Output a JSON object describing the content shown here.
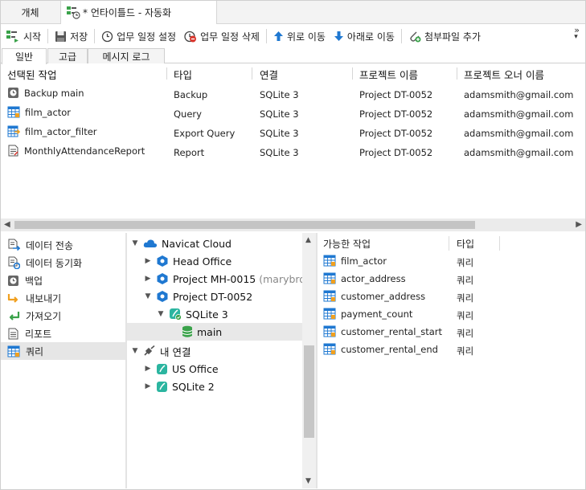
{
  "tabs": {
    "objects_label": "개체",
    "active_label": "* 언타이틀드 - 자동화"
  },
  "toolbar": {
    "start": "시작",
    "save": "저장",
    "set_schedule": "업무 일정 설정",
    "delete_schedule": "업무 일정 삭제",
    "move_up": "위로 이동",
    "move_down": "아래로 이동",
    "add_attachment": "첨부파일 추가",
    "overflow": "»"
  },
  "subtabs": [
    "일반",
    "고급",
    "메시지 로그"
  ],
  "jobs": {
    "columns": [
      "선택된 작업",
      "타입",
      "연결",
      "프로젝트 이름",
      "프로젝트 오너 이름"
    ],
    "rows": [
      {
        "name": "Backup main",
        "type": "Backup",
        "connection": "SQLite 3",
        "project": "Project DT-0052",
        "owner": "adamsmith@gmail.com",
        "icon": "backup-icon"
      },
      {
        "name": "film_actor",
        "type": "Query",
        "connection": "SQLite 3",
        "project": "Project DT-0052",
        "owner": "adamsmith@gmail.com",
        "icon": "query-icon"
      },
      {
        "name": "film_actor_filter",
        "type": "Export Query",
        "connection": "SQLite 3",
        "project": "Project DT-0052",
        "owner": "adamsmith@gmail.com",
        "icon": "export-query-icon"
      },
      {
        "name": "MonthlyAttendanceReport",
        "type": "Report",
        "connection": "SQLite 3",
        "project": "Project DT-0052",
        "owner": "adamsmith@gmail.com",
        "icon": "report-icon"
      }
    ]
  },
  "categories": [
    {
      "label": "데이터 전송",
      "icon": "data-transfer-icon"
    },
    {
      "label": "데이터 동기화",
      "icon": "data-sync-icon"
    },
    {
      "label": "백업",
      "icon": "backup-icon"
    },
    {
      "label": "내보내기",
      "icon": "export-icon"
    },
    {
      "label": "가져오기",
      "icon": "import-icon"
    },
    {
      "label": "리포트",
      "icon": "report-icon"
    },
    {
      "label": "쿼리",
      "icon": "query-icon",
      "selected": true
    }
  ],
  "tree": {
    "cloud_root": "Navicat Cloud",
    "head_office": "Head Office",
    "project_mh": "Project MH-0015",
    "project_mh_owner": "(marybrow",
    "project_dt": "Project DT-0052",
    "sqlite3": "SQLite 3",
    "main": "main",
    "local_root": "내 연결",
    "us_office": "US Office",
    "sqlite2": "SQLite 2"
  },
  "available": {
    "columns": [
      "가능한 작업",
      "타입"
    ],
    "rows": [
      {
        "name": "film_actor",
        "type": "쿼리"
      },
      {
        "name": "actor_address",
        "type": "쿼리"
      },
      {
        "name": "customer_address",
        "type": "쿼리"
      },
      {
        "name": "payment_count",
        "type": "쿼리"
      },
      {
        "name": "customer_rental_start",
        "type": "쿼리"
      },
      {
        "name": "customer_rental_end",
        "type": "쿼리"
      }
    ]
  },
  "colors": {
    "accent_blue": "#1f78d1",
    "green": "#3aa24a",
    "red": "#d9342b",
    "orange": "#f0a020"
  }
}
